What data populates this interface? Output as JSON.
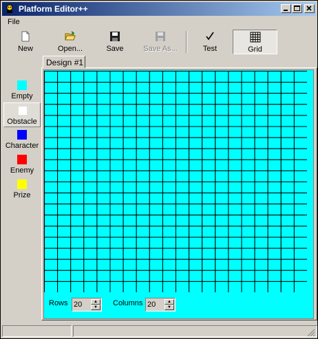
{
  "window": {
    "title": "Platform Editor++"
  },
  "menu": {
    "items": [
      "File"
    ]
  },
  "toolbar": {
    "buttons": [
      {
        "label": "New",
        "icon": "new-file-icon"
      },
      {
        "label": "Open...",
        "icon": "open-folder-icon"
      },
      {
        "label": "Save",
        "icon": "floppy-disk-icon"
      },
      {
        "label": "Save As...",
        "icon": "save-as-icon",
        "disabled": true
      },
      {
        "label": "Test",
        "icon": "checkmark-icon"
      },
      {
        "label": "Grid",
        "icon": "grid-icon",
        "pressed": true
      }
    ]
  },
  "palette": {
    "selected": "Obstacle",
    "items": [
      {
        "label": "Empty",
        "color": "#00ffff"
      },
      {
        "label": "Obstacle",
        "color": "#ffffff"
      },
      {
        "label": "Character",
        "color": "#0000ff"
      },
      {
        "label": "Enemy",
        "color": "#ff0000"
      },
      {
        "label": "Prize",
        "color": "#ffff00"
      }
    ]
  },
  "tabs": [
    {
      "label": "Design #1"
    }
  ],
  "design": {
    "background_color": "#00ffff",
    "grid_rows": 20,
    "grid_columns": 20,
    "rows_label": "Rows",
    "rows_value": "20",
    "columns_label": "Columns",
    "columns_value": "20"
  }
}
